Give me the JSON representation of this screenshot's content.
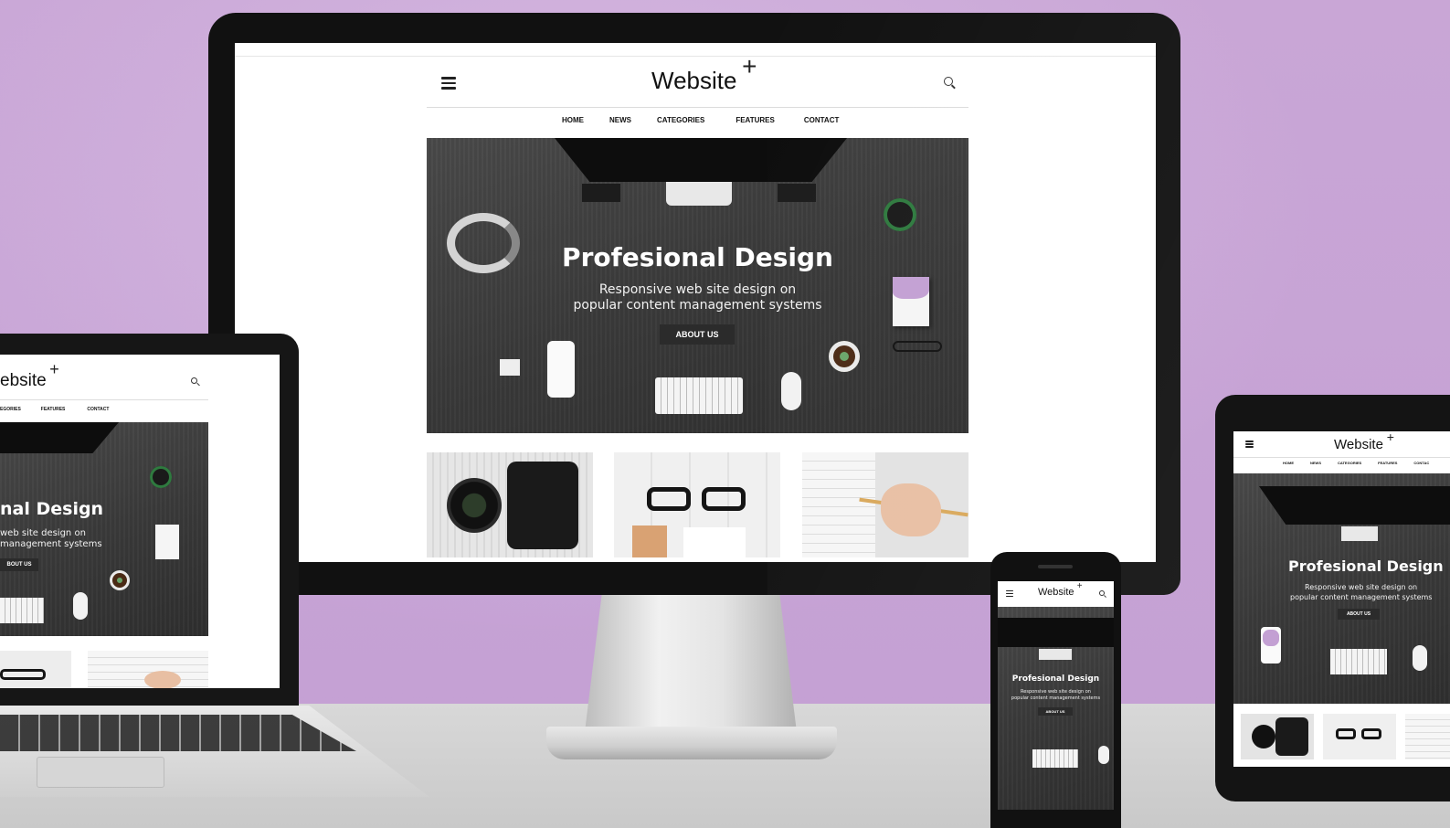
{
  "site": {
    "logo": "Website",
    "logo_plus": "+",
    "nav": [
      "HOME",
      "NEWS",
      "CATEGORIES",
      "FEATURES",
      "CONTACT"
    ],
    "hero_title": "Profesional Design",
    "hero_sub_line1": "Responsive web site design on",
    "hero_sub_line2": "popular content management systems",
    "hero_button": "ABOUT US"
  },
  "laptop": {
    "logo": "ebsite",
    "nav": [
      "EGORIES",
      "FEATURES",
      "CONTACT"
    ],
    "hero_title": "nal Design",
    "hero_sub_line1": "web site design on",
    "hero_sub_line2": "management systems",
    "hero_button": "BOUT US"
  },
  "tablet": {
    "nav": [
      "HOME",
      "NEWS",
      "CATEGORIES",
      "FEATURES",
      "CONTAC"
    ]
  },
  "colors": {
    "background": "#c8a5d5",
    "desk": "#d2d2d2",
    "bezel": "#111111",
    "hero": "#3c3c3c"
  },
  "icons": {
    "menu": "hamburger-icon",
    "search": "search-icon"
  }
}
